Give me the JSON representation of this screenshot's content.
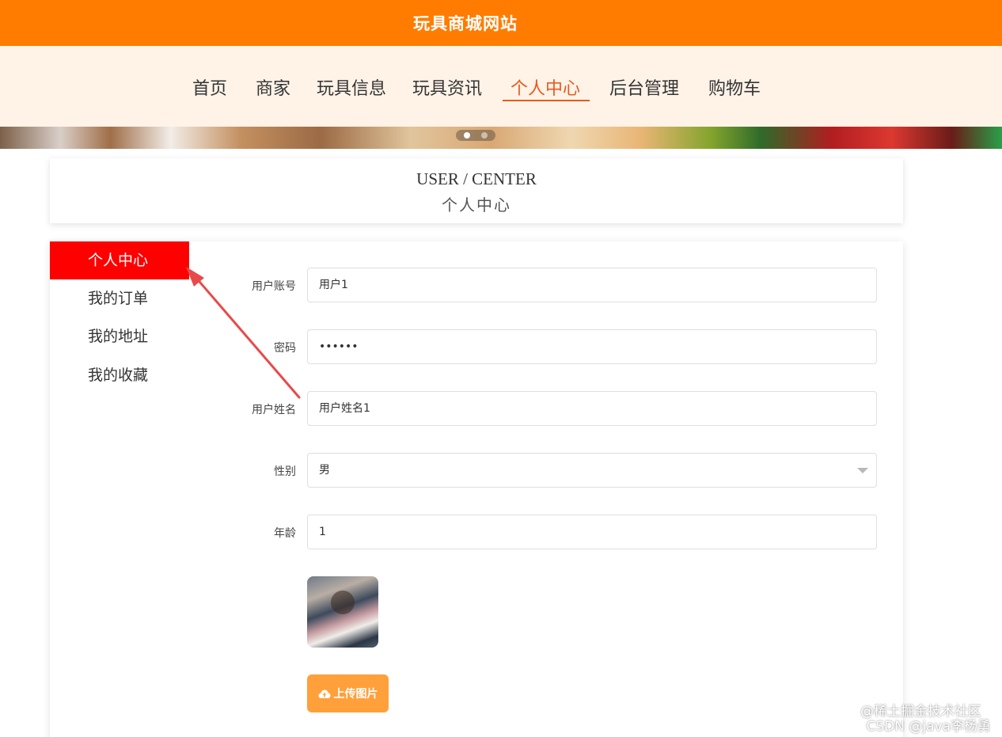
{
  "header": {
    "site_title": "玩具商城网站"
  },
  "nav": {
    "items": [
      {
        "label": "首页"
      },
      {
        "label": "商家"
      },
      {
        "label": "玩具信息"
      },
      {
        "label": "玩具资讯"
      },
      {
        "label": "个人中心"
      },
      {
        "label": "后台管理"
      },
      {
        "label": "购物车"
      }
    ],
    "active": "个人中心"
  },
  "banner": {
    "slide_count": 2,
    "active_slide": 1
  },
  "section_title": {
    "en": "USER / CENTER",
    "cn": "个人中心"
  },
  "sidebar": {
    "items": [
      {
        "label": "个人中心"
      },
      {
        "label": "我的订单"
      },
      {
        "label": "我的地址"
      },
      {
        "label": "我的收藏"
      }
    ],
    "active": "个人中心"
  },
  "form": {
    "username": {
      "label": "用户账号",
      "value": "用户1"
    },
    "password": {
      "label": "密码",
      "value": "••••••"
    },
    "fullname": {
      "label": "用户姓名",
      "value": "用户姓名1"
    },
    "gender": {
      "label": "性别",
      "value": "男"
    },
    "age": {
      "label": "年龄",
      "value": "1"
    },
    "upload_label": "上传图片"
  },
  "watermarks": {
    "line1": "@稀土掘金技术社区",
    "line2": "CSDN @java李杨勇"
  },
  "colors": {
    "header_bg": "#ff7c00",
    "nav_bg": "#fff3e8",
    "nav_active": "#e65a1e",
    "sidebar_active": "#ff0000",
    "upload_button": "#ffa03a",
    "annotation_arrow": "#e84a4a"
  },
  "icons": {
    "upload": "cloud-upload-icon",
    "select": "chevron-down-icon"
  }
}
